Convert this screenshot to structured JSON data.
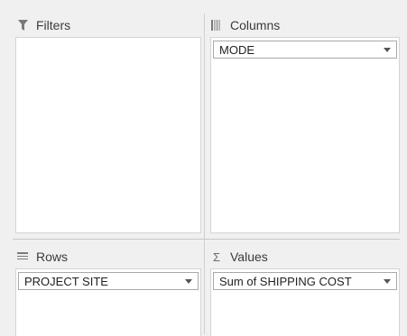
{
  "filters": {
    "title": "Filters",
    "icon": "filter-icon"
  },
  "columns": {
    "title": "Columns",
    "icon": "columns-icon",
    "fields": [
      "MODE"
    ]
  },
  "rows": {
    "title": "Rows",
    "icon": "rows-icon",
    "fields": [
      "PROJECT SITE"
    ]
  },
  "values": {
    "title": "Values",
    "icon": "sigma-icon",
    "symbol": "Σ",
    "fields": [
      "Sum of SHIPPING COST"
    ]
  }
}
